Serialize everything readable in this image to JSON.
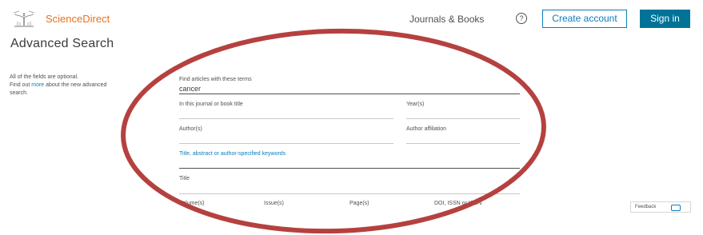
{
  "header": {
    "brand": "ScienceDirect",
    "nav_journals": "Journals & Books",
    "help_icon_glyph": "?",
    "create_account": "Create account",
    "sign_in": "Sign in"
  },
  "page": {
    "title": "Advanced Search"
  },
  "side_note": {
    "line1": "All of the fields are optional.",
    "line2_prefix": "Find out ",
    "line2_link": "more",
    "line2_suffix": " about the new advanced",
    "line3": "search."
  },
  "form": {
    "terms_label": "Find articles with these terms",
    "terms_value": "cancer",
    "journal_label": "In this journal or book title",
    "year_label": "Year(s)",
    "author_label": "Author(s)",
    "affiliation_label": "Author affiliation",
    "keywords_label": "Title, abstract or author-specified keywords",
    "title_label": "Title",
    "volume_label": "Volume(s)",
    "issue_label": "Issue(s)",
    "page_label": "Page(s)",
    "doi_label": "DOI, ISSN or ISBN"
  },
  "feedback": {
    "label": "Feedback"
  },
  "colors": {
    "brand_orange": "#e9711c",
    "link_blue": "#0c7dbb",
    "signin_bg": "#007398",
    "annotation_red": "#b5413f"
  }
}
